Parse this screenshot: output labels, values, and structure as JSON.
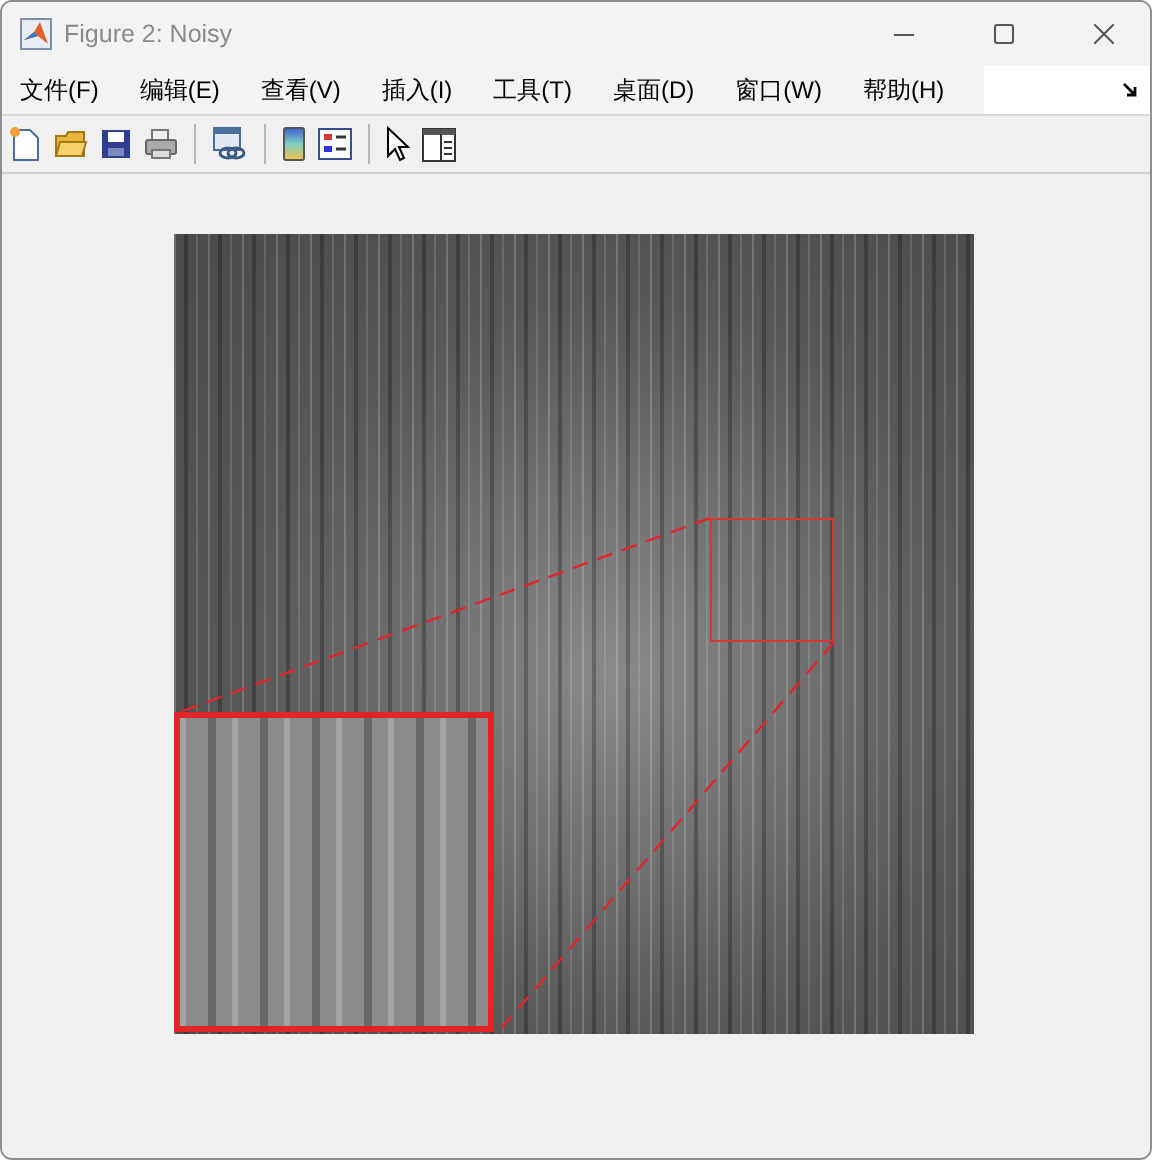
{
  "window": {
    "title": "Figure 2: Noisy"
  },
  "menu": [
    {
      "label": "文件(F)"
    },
    {
      "label": "编辑(E)"
    },
    {
      "label": "查看(V)"
    },
    {
      "label": "插入(I)"
    },
    {
      "label": "工具(T)"
    },
    {
      "label": "桌面(D)"
    },
    {
      "label": "窗口(W)"
    },
    {
      "label": "帮助(H)"
    }
  ]
}
